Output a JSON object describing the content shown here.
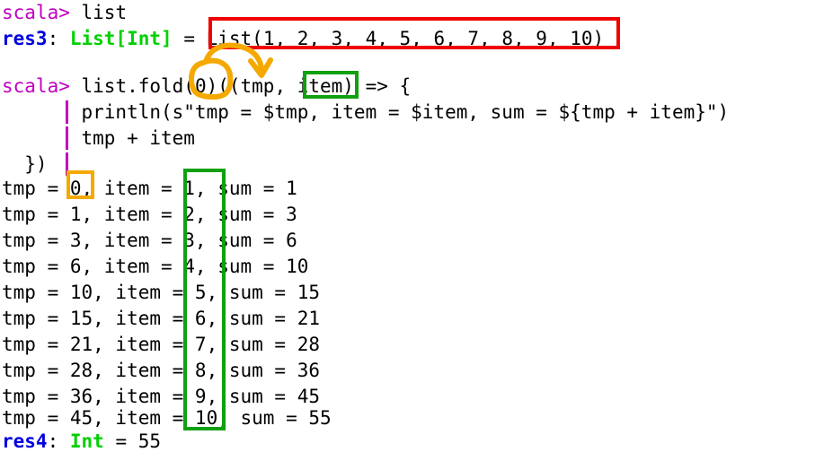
{
  "terminal": {
    "kind": "scala-repl",
    "background_color": "#ffffff",
    "foreground_color": "#000000",
    "prompt_color": "#c000c0",
    "result_name_color": "#0000e0",
    "type_name_color": "#00d000",
    "prompt_label": "scala>",
    "continuation_bar": "|",
    "lines": {
      "l1_prompt": "scala> ",
      "l1_input": "list",
      "l2_res_name": "res3",
      "l2_colon": ": ",
      "l2_type": "List[Int]",
      "l2_eq": " = ",
      "l2_value": "List(1, 2, 3, 4, 5, 6, 7, 8, 9, 10)",
      "l4_prompt": "scala> ",
      "l4_input": "list.fold(0)((tmp, item) => {",
      "l5_input": "       println(s\"tmp = $tmp, item = $item, sum = ${tmp + item}\")",
      "l6_input": "       tmp + item",
      "l7_input": "  })",
      "out1": "tmp = 0, item = 1, sum = 1",
      "out2": "tmp = 1, item = 2, sum = 3",
      "out3": "tmp = 3, item = 3, sum = 6",
      "out4": "tmp = 6, item = 4, sum = 10",
      "out5": "tmp = 10, item = 5, sum = 15",
      "out6": "tmp = 15, item = 6, sum = 21",
      "out7": "tmp = 21, item = 7, sum = 28",
      "out8": "tmp = 28, item = 8, sum = 36",
      "out9": "tmp = 36, item = 9, sum = 45",
      "out10": "tmp = 45, item = 10, sum = 55",
      "l_last_res_name": "res4",
      "l_last_colon": ": ",
      "l_last_type": "Int",
      "l_last_eq": " = ",
      "l_last_value": "55"
    }
  },
  "annotations": {
    "red_box": {
      "label": "list-literal-highlight",
      "color": "#f00000",
      "targets_text": "List(1, 2, 3, 4, 5, 6, 7, 8, 9, 10)"
    },
    "green_box_item": {
      "label": "item-parameter-highlight",
      "color": "#10a010",
      "targets_text": "item"
    },
    "green_box_column": {
      "label": "item-values-column-highlight",
      "color": "#10a010",
      "targets_text": "1, 2, 3, 4, 5, 6, 7, 8, 9, 10"
    },
    "yellow_circle_zero": {
      "label": "fold-seed-circle",
      "color": "#f5a900",
      "targets_text": "0"
    },
    "yellow_box_zero": {
      "label": "first-tmp-value-highlight",
      "color": "#f5a900",
      "targets_text": "0"
    },
    "yellow_arrow": {
      "label": "seed-to-tmp-arrow",
      "color": "#f5a900"
    }
  }
}
